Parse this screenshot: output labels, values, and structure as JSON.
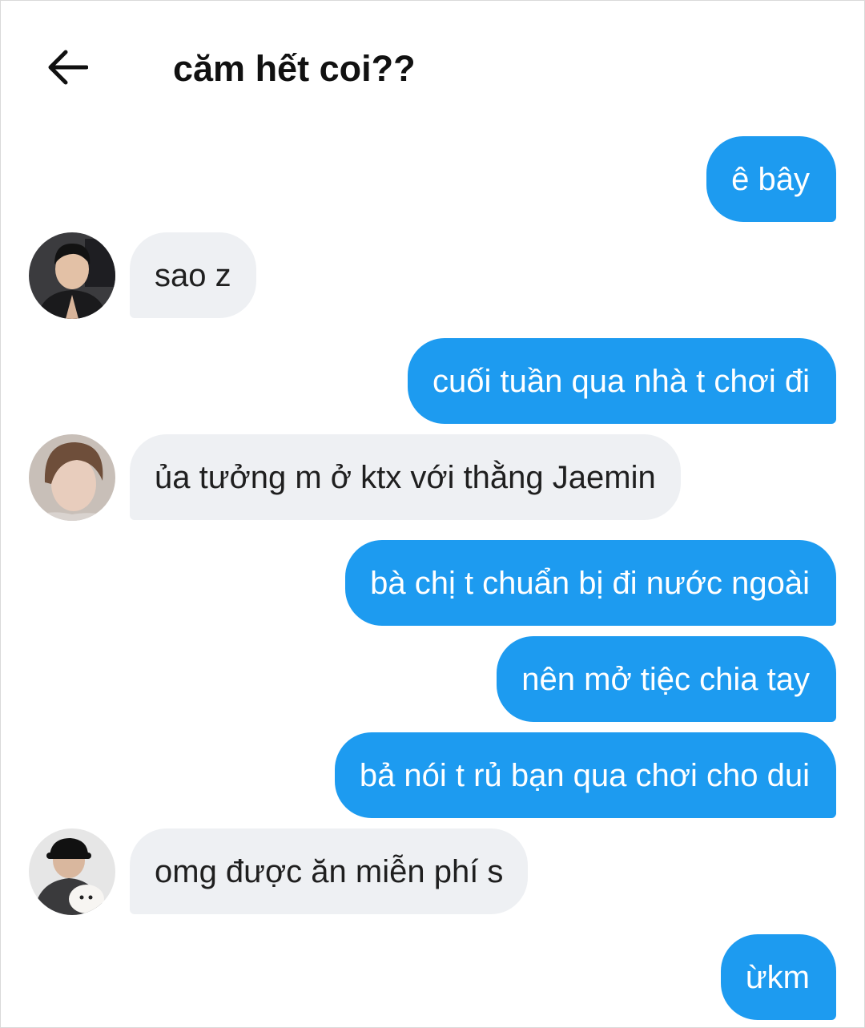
{
  "header": {
    "back_icon": "arrow-left-icon",
    "title": "căm hết coi??"
  },
  "messages": [
    {
      "side": "sent",
      "text": "ê bây"
    },
    {
      "side": "received",
      "text": "sao z",
      "avatar": "user-photo-1"
    },
    {
      "side": "sent",
      "text": "cuối tuần qua nhà t chơi đi"
    },
    {
      "side": "received",
      "text": "ủa tưởng m ở ktx với thằng Jaemin",
      "avatar": "user-photo-2"
    },
    {
      "side": "sent",
      "text": "bà chị t chuẩn bị đi nước ngoài"
    },
    {
      "side": "sent",
      "text": "nên mở tiệc chia tay"
    },
    {
      "side": "sent",
      "text": "bả nói t rủ bạn qua chơi cho dui"
    },
    {
      "side": "received",
      "text": "omg được ăn miễn phí s",
      "avatar": "user-photo-3"
    },
    {
      "side": "sent",
      "text": "ừkm"
    }
  ],
  "colors": {
    "sent_bubble": "#1d9bf0",
    "received_bubble": "#eef0f3",
    "background": "#ffffff"
  }
}
